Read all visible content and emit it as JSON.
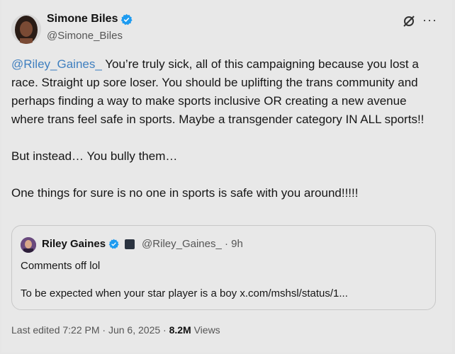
{
  "author": {
    "name": "Simone Biles",
    "handle": "@Simone_Biles"
  },
  "icons": {
    "verified": "verified-badge-icon",
    "grok": "grok-icon",
    "more": "more-icon",
    "affiliate": "affiliate-badge-icon"
  },
  "colors": {
    "verified": "#1d9bf0",
    "mention": "#3f7fbf"
  },
  "body": {
    "mention": "@Riley_Gaines_",
    "line1_rest": " You’re truly sick, all of this campaigning because you lost a race. Straight up sore loser. You should be uplifting the trans community and perhaps finding a way to make sports inclusive OR creating a new avenue where trans feel safe in sports. Maybe a transgender category IN ALL sports!!",
    "paragraph2": "But instead… You bully them…",
    "paragraph3": "One things for sure is no one in sports is safe with you around!!!!!"
  },
  "quoted": {
    "name": "Riley Gaines",
    "handle_time": "@Riley_Gaines_ · 9h",
    "line1": "Comments off lol",
    "line2": "To be expected when your star player is a boy x.com/mshsl/status/1..."
  },
  "meta": {
    "edited": "Last edited 7:22 PM · Jun 6, 2025 · ",
    "views_count": "8.2M",
    "views_label": " Views"
  }
}
